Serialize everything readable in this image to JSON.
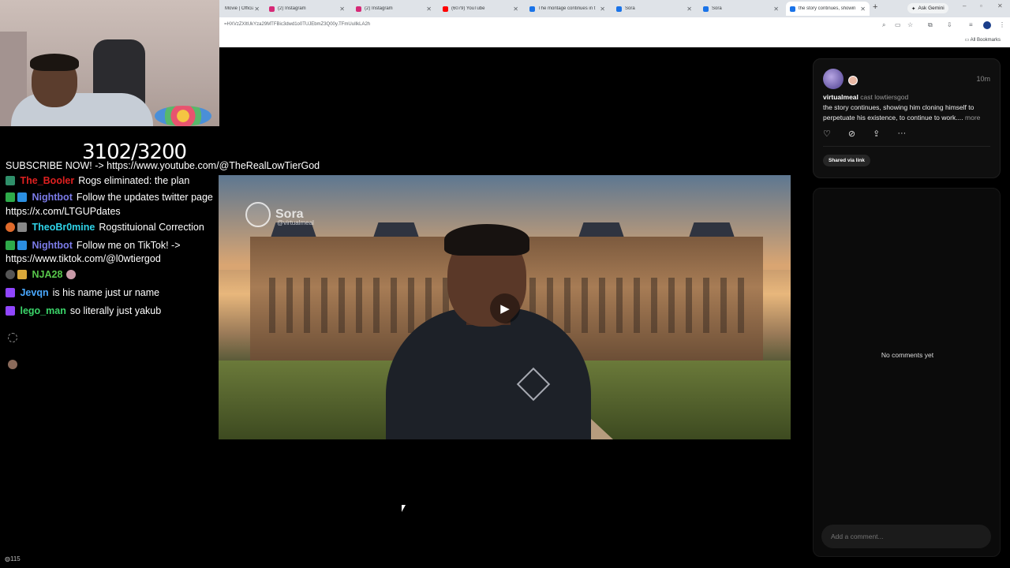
{
  "browser": {
    "tabs": [
      {
        "title": "Movie | Official",
        "color": "#777"
      },
      {
        "title": "(2) Instagram",
        "color": "#d62976"
      },
      {
        "title": "(2) Instagram",
        "color": "#d62976"
      },
      {
        "title": "(6079) YouTube",
        "color": "#ff0000"
      },
      {
        "title": "The montage continues in t",
        "color": "#1a73e8"
      },
      {
        "title": "Sora",
        "color": "#1a73e8"
      },
      {
        "title": "Sora",
        "color": "#1a73e8"
      },
      {
        "title": "the story continues, showin",
        "color": "#1a73e8"
      }
    ],
    "new_tab": "+",
    "ask_gemini": "Ask Gemini",
    "url": "=HXVzZXItUkYza29MTFBic3dwd1o0TUJEbmZ3Q00y.TFmUuIlkLA2h",
    "all_bookmarks": "All Bookmarks"
  },
  "stream": {
    "counter": "3102/3200",
    "chat": [
      {
        "user": "",
        "text": "SUBSCRIBE NOW! -> https://www.youtube.com/@TheRealLowTierGod",
        "color": "#ffffff"
      },
      {
        "user": "The_Booler",
        "text": "Rogs eliminated: the plan",
        "color": "#e02020"
      },
      {
        "user": "Nightbot",
        "text": "Follow the updates twitter page",
        "text2": "https://x.com/LTGUPdates",
        "color": "#7b7be8"
      },
      {
        "user": "TheoBr0mine",
        "text": "Rogstituional Correction",
        "color": "#2fd3e8"
      },
      {
        "user": "Nightbot",
        "text": "Follow me on TikTok! ->",
        "text2": "https://www.tiktok.com/@l0wtiergod",
        "color": "#7b7be8"
      },
      {
        "user": "NJA28",
        "text": "",
        "color": "#58c74b"
      },
      {
        "user": "Jevqn",
        "text": "is his name just ur name",
        "color": "#4aa8ff"
      },
      {
        "user": "lego_man",
        "text": "so literally just yakub",
        "color": "#3bd66a"
      }
    ],
    "viewer_count": "115"
  },
  "video": {
    "watermark": "Sora",
    "watermark_handle": "@virtualmeal",
    "play_icon": "play-icon"
  },
  "post": {
    "time": "10m",
    "author": "virtualmeal",
    "cast": "cast lowtiersgod",
    "caption": "the story continues, showing him cloning himself to perpetuate his existence, to continue to work....",
    "more": "more",
    "shared": "Shared via link"
  },
  "comments": {
    "empty": "No comments yet",
    "placeholder": "Add a comment..."
  }
}
